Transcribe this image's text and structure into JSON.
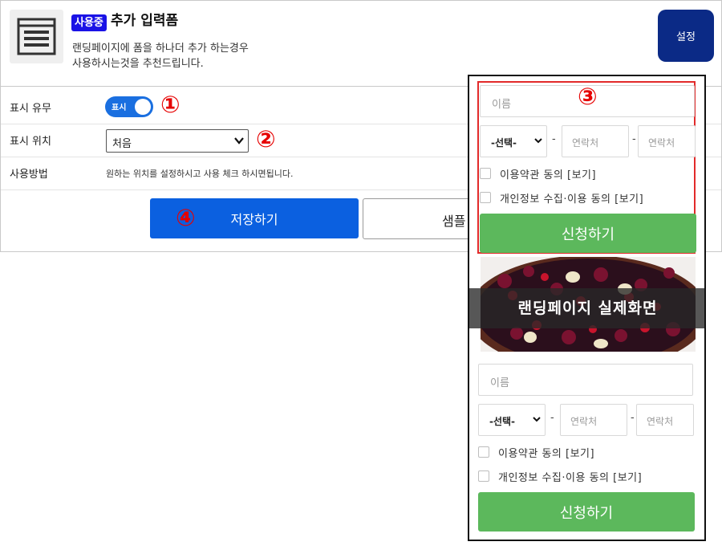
{
  "header": {
    "badge": "사용중",
    "title": "추가 입력폼",
    "desc_line1": "랜딩페이지에 폼을 하나더 추가 하는경우",
    "desc_line2": "사용하시는것을 추천드립니다.",
    "settings_label": "설정",
    "icon": "form-window-icon"
  },
  "rows": {
    "display": {
      "label": "표시 유무",
      "toggle_text": "표시",
      "toggle_on": true
    },
    "position": {
      "label": "표시 위치",
      "selected": "처음"
    },
    "usage": {
      "label": "사용방법",
      "text": "원하는 위치를 설정하시고 사용 체크 하시면됩니다."
    }
  },
  "markers": {
    "m1": "①",
    "m2": "②",
    "m3": "③",
    "m4": "④"
  },
  "actions": {
    "save_label": "저장하기",
    "sample_label": "샘플"
  },
  "preview": {
    "overlay_text": "랜딩페이지 실제화면",
    "form": {
      "name_placeholder": "이름",
      "select_value": "-선택-",
      "dash": "-",
      "phone_placeholder": "연락처",
      "terms_label": "이용약관 동의 [보기]",
      "privacy_label": "개인정보 수집·이용 동의 [보기]",
      "submit_label": "신청하기"
    }
  },
  "colors": {
    "accent_blue": "#0b60e0",
    "settings_navy": "#0b2a86",
    "badge_blue": "#1a12e6",
    "marker_red": "#e60000",
    "submit_green": "#5cb85c"
  }
}
